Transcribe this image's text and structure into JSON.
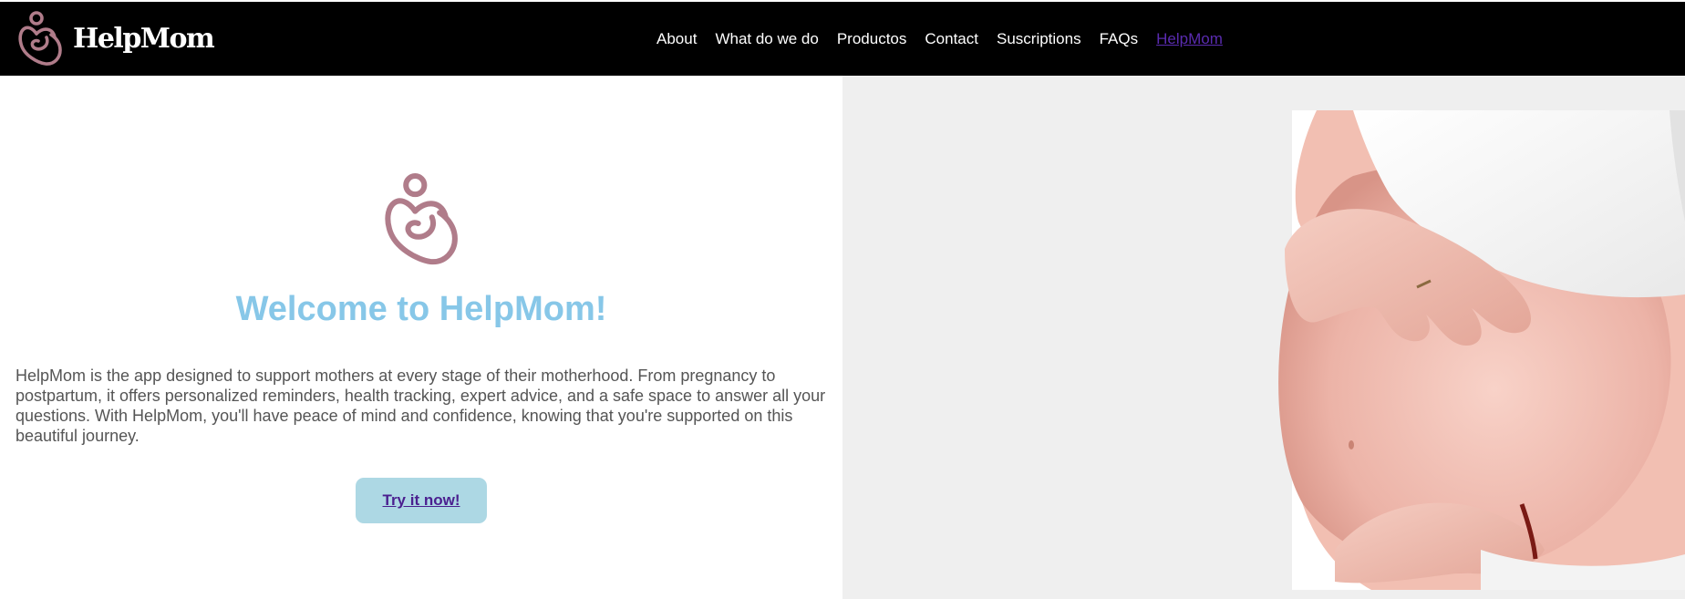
{
  "brand": {
    "name": "HelpMom",
    "logo_icon": "mother-child-heart-icon",
    "color": "#b07c8a"
  },
  "nav": {
    "links": [
      {
        "label": "About"
      },
      {
        "label": "What do we do"
      },
      {
        "label": "Productos"
      },
      {
        "label": "Contact"
      },
      {
        "label": "Suscriptions"
      },
      {
        "label": "FAQs"
      },
      {
        "label": "HelpMom",
        "active": true
      }
    ]
  },
  "hero": {
    "title": "Welcome to HelpMom!",
    "description": "HelpMom is the app designed to support mothers at every stage of their motherhood. From pregnancy to postpartum, it offers personalized reminders, health tracking, expert advice, and a safe space to answer all your questions. With HelpMom, you'll have peace of mind and confidence, knowing that you're supported on this beautiful journey.",
    "cta_label": "Try it now!",
    "title_color": "#87c7e8",
    "cta_color": "#add8e4"
  }
}
